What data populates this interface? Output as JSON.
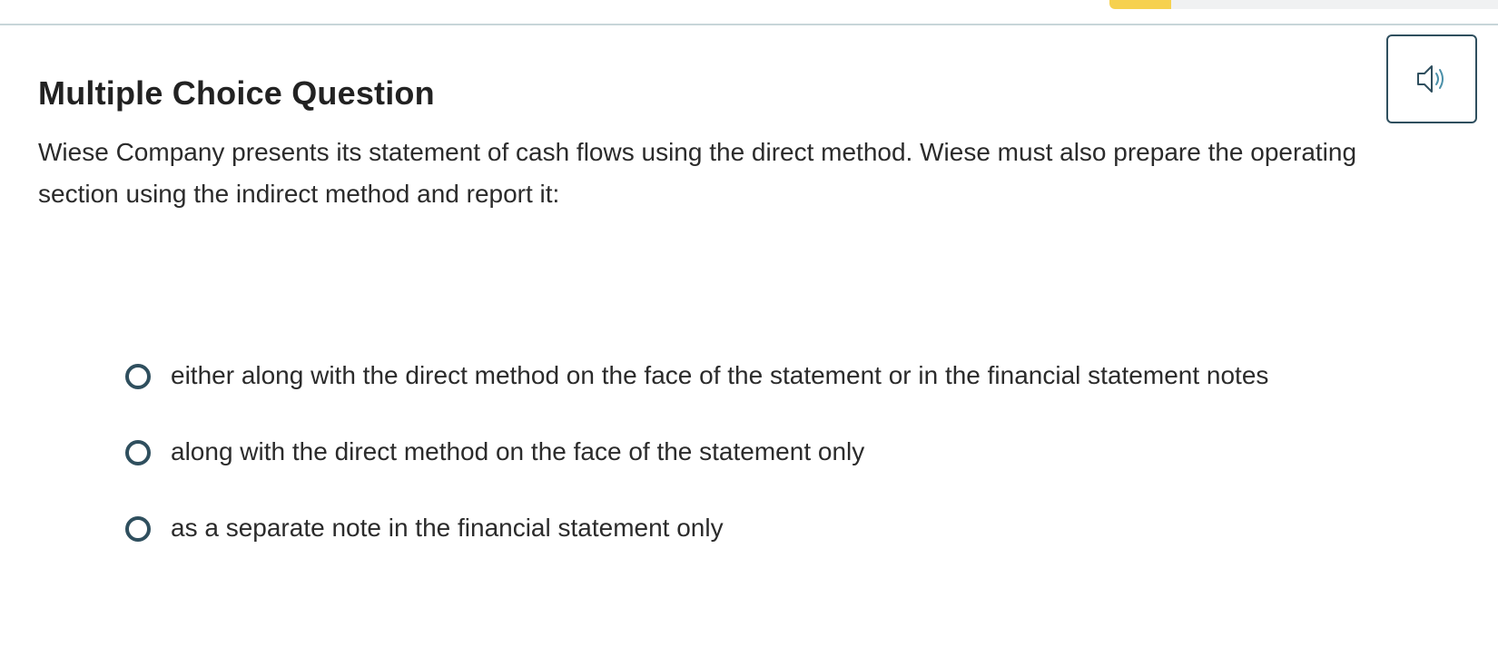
{
  "header": {
    "progress_fraction": 0.16,
    "progress_color": "#f6d14f",
    "track_color": "#f0f1f2",
    "divider_color": "#c8d6d9"
  },
  "question": {
    "type_title": "Multiple Choice Question",
    "audio_icon": "speaker-icon",
    "prompt": "Wiese Company presents its statement of cash flows using the direct method. Wiese must also prepare the operating section using the indirect method and report it:",
    "options": [
      {
        "label": "either along with the direct method on the face of the statement or in the financial statement notes",
        "selected": false
      },
      {
        "label": "along with the direct method on the face of the statement only",
        "selected": false
      },
      {
        "label": "as a separate note in the financial statement only",
        "selected": false
      }
    ]
  },
  "colors": {
    "accent": "#2f4f5e",
    "text": "#2b2b2b",
    "speaker_waves": "#4a8fa8"
  }
}
